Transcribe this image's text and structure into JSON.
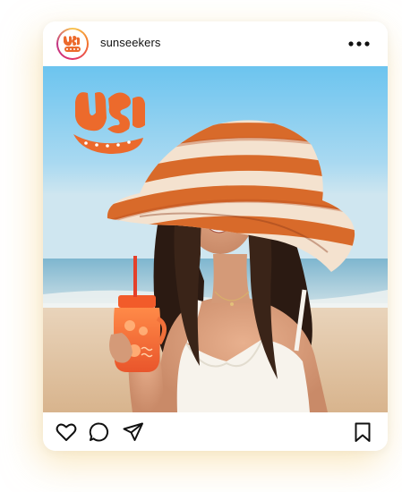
{
  "post": {
    "username": "sunseekers",
    "logo_text": "SUN seekers",
    "avatar_icon": "sunseekers-logo-icon",
    "more_icon": "more-horizontal-icon",
    "photo_alt": "",
    "actions": {
      "like_icon": "heart-icon",
      "comment_icon": "comment-bubble-icon",
      "share_icon": "paper-plane-icon",
      "save_icon": "bookmark-icon"
    }
  },
  "colors": {
    "brand_orange": "#ec6a2c",
    "brand_pink": "#e1306c",
    "sky_top": "#7cc6ee",
    "sand": "#e6cbaa"
  }
}
